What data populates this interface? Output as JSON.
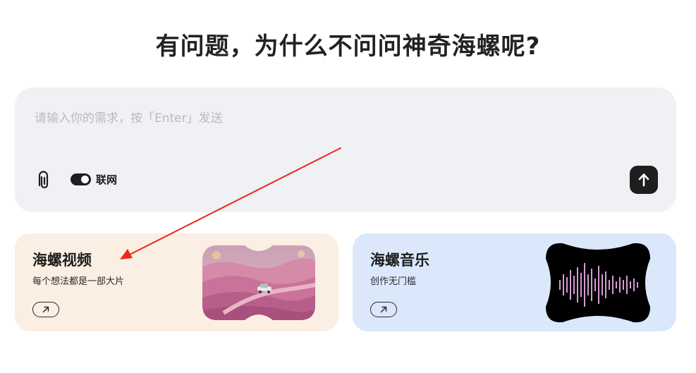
{
  "page": {
    "title": "有问题，为什么不问问神奇海螺呢?"
  },
  "prompt": {
    "placeholder": "请输入你的需求，按「Enter」发送",
    "value": "",
    "attach_icon": "paperclip-icon",
    "network_toggle": {
      "label": "联网",
      "on": true
    },
    "send_icon": "arrow-up-icon"
  },
  "cards": [
    {
      "id": "video",
      "title": "海螺视频",
      "subtitle": "每个想法都是一部大片",
      "link_icon": "arrow-up-right-icon",
      "background": "#fbeee3"
    },
    {
      "id": "music",
      "title": "海螺音乐",
      "subtitle": "创作无门槛",
      "link_icon": "arrow-up-right-icon",
      "background": "#dbe8fb"
    }
  ],
  "colors": {
    "annotation_arrow": "#e8291c",
    "dark": "#1e1e1e",
    "prompt_bg": "#f0f1f4"
  }
}
